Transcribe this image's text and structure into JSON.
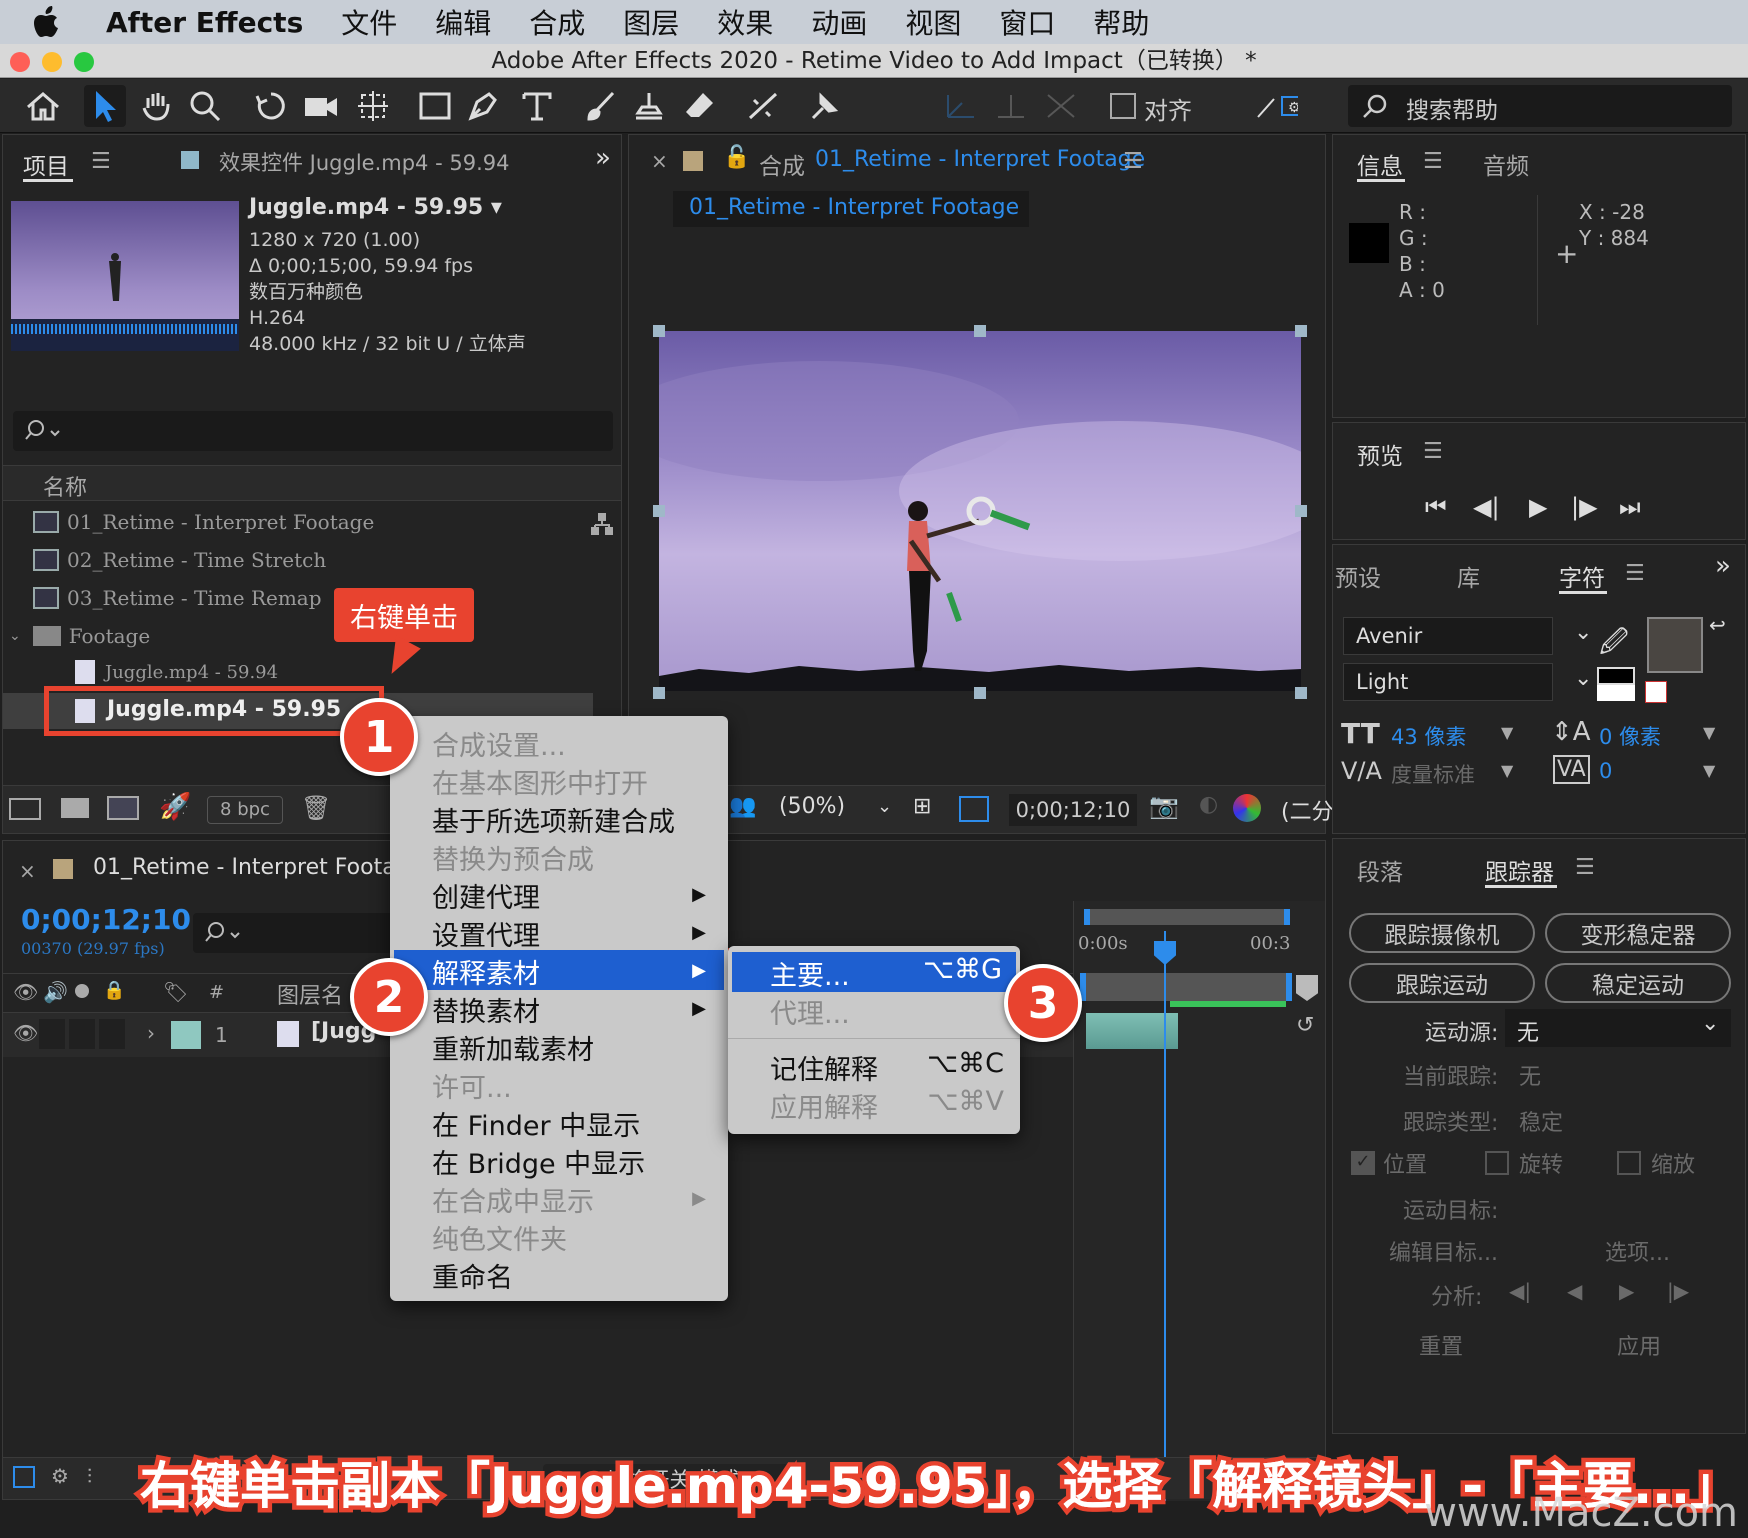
{
  "menubar": {
    "app": "After Effects",
    "items": [
      "文件",
      "编辑",
      "合成",
      "图层",
      "效果",
      "动画",
      "视图",
      "窗口",
      "帮助"
    ]
  },
  "window": {
    "title": "Adobe After Effects 2020 - Retime Video to Add Impact（已转换） *"
  },
  "toolbar": {
    "snap_label": "对齐",
    "search_placeholder": "搜索帮助"
  },
  "project_panel": {
    "tab_project": "项目",
    "tab_effects": "效果控件 Juggle.mp4 - 59.94",
    "preview": {
      "name": "Juggle.mp4 - 59.95 ▾",
      "info": [
        "1280 x 720 (1.00)",
        "Δ 0;00;15;00, 59.94 fps",
        "数百万种颜色",
        "H.264",
        "48.000 kHz / 32 bit U / 立体声"
      ]
    },
    "column_name": "名称",
    "items": [
      {
        "label": "01_Retime - Interpret Footage",
        "type": "comp"
      },
      {
        "label": "02_Retime - Time Stretch",
        "type": "comp"
      },
      {
        "label": "03_Retime - Time Remap",
        "type": "comp"
      },
      {
        "label": "Footage",
        "type": "folder"
      },
      {
        "label": "Juggle.mp4 - 59.94",
        "type": "footage"
      },
      {
        "label": "Juggle.mp4 - 59.95",
        "type": "footage",
        "selected": true
      }
    ],
    "bpc": "8 bpc"
  },
  "comp_panel": {
    "tab_title_prefix": "合成",
    "tab_title": "01_Retime - Interpret Footage",
    "sub_tab": "01_Retime - Interpret Footage",
    "zoom": "(50%)",
    "timecode": "0;00;12;10",
    "resolution": "(二分"
  },
  "info_panel": {
    "tab_info": "信息",
    "tab_audio": "音频",
    "r": "R :",
    "g": "G :",
    "b": "B :",
    "a": "A :  0",
    "x": "X : -28",
    "y": "Y :  884"
  },
  "preview_panel": {
    "title": "预览"
  },
  "character_panel": {
    "tabs": [
      "预设",
      "库",
      "字符"
    ],
    "font": "Avenir",
    "style": "Light",
    "size": "43 像素",
    "leading": "0 像素",
    "kerning": "度量标准",
    "tracking": "0"
  },
  "tracker_panel": {
    "tab_paragraph": "段落",
    "tab_tracker": "跟踪器",
    "buttons": [
      "跟踪摄像机",
      "变形稳定器",
      "跟踪运动",
      "稳定运动"
    ],
    "motion_source_label": "运动源:",
    "motion_source_value": "无",
    "current_track_label": "当前跟踪:",
    "current_track_value": "无",
    "track_type_label": "跟踪类型:",
    "track_type_value": "稳定",
    "checks": [
      "位置",
      "旋转",
      "缩放"
    ],
    "motion_target": "运动目标:",
    "edit_target": "编辑目标...",
    "options": "选项...",
    "analyze": "分析:",
    "reset": "重置",
    "apply": "应用"
  },
  "timeline": {
    "tab_title": "01_Retime - Interpret Footage",
    "timecode": "0;00;12;10",
    "frames": "00370 (29.97 fps)",
    "layer_name_header": "图层名",
    "layer_index": "1",
    "layer_name": "[Jugg",
    "ruler_start": "0:00s",
    "ruler_end": "00:3",
    "toggle_label": "切换开关/模式"
  },
  "context_menu": {
    "items": [
      {
        "label": "合成设置...",
        "enabled": false
      },
      {
        "label": "在基本图形中打开",
        "enabled": false
      },
      {
        "label": "基于所选项新建合成",
        "enabled": true
      },
      {
        "label": "替换为预合成",
        "enabled": false
      },
      {
        "label": "创建代理",
        "enabled": true,
        "submenu": true
      },
      {
        "label": "设置代理",
        "enabled": true,
        "submenu": true
      },
      {
        "label": "解释素材",
        "enabled": true,
        "submenu": true,
        "highlighted": true
      },
      {
        "label": "替换素材",
        "enabled": true,
        "submenu": true
      },
      {
        "label": "重新加载素材",
        "enabled": true
      },
      {
        "label": "许可...",
        "enabled": false
      },
      {
        "label": "在 Finder 中显示",
        "enabled": true
      },
      {
        "label": "在 Bridge 中显示",
        "enabled": true
      },
      {
        "label": "在合成中显示",
        "enabled": false,
        "submenu": true
      },
      {
        "label": "纯色文件夹",
        "enabled": false
      },
      {
        "label": "重命名",
        "enabled": true
      }
    ]
  },
  "submenu": {
    "items": [
      {
        "label": "主要...",
        "shortcut": "⌥⌘G",
        "highlighted": true
      },
      {
        "label": "代理...",
        "shortcut": "",
        "enabled": false
      },
      {
        "label": "记住解释",
        "shortcut": "⌥⌘C"
      },
      {
        "label": "应用解释",
        "shortcut": "⌥⌘V",
        "enabled": false
      }
    ]
  },
  "annotations": {
    "callout": "右键单击",
    "badge1": "1",
    "badge2": "2",
    "badge3": "3",
    "caption": "右键单击副本「Juggle.mp4-59.95」，选择「解释镜头」-「主要...」",
    "watermark": "www.MacZ.com"
  },
  "colors": {
    "accent_blue": "#2d8ceb",
    "highlight_blue": "#1e5fd0",
    "annotation_red": "#e8432f"
  }
}
